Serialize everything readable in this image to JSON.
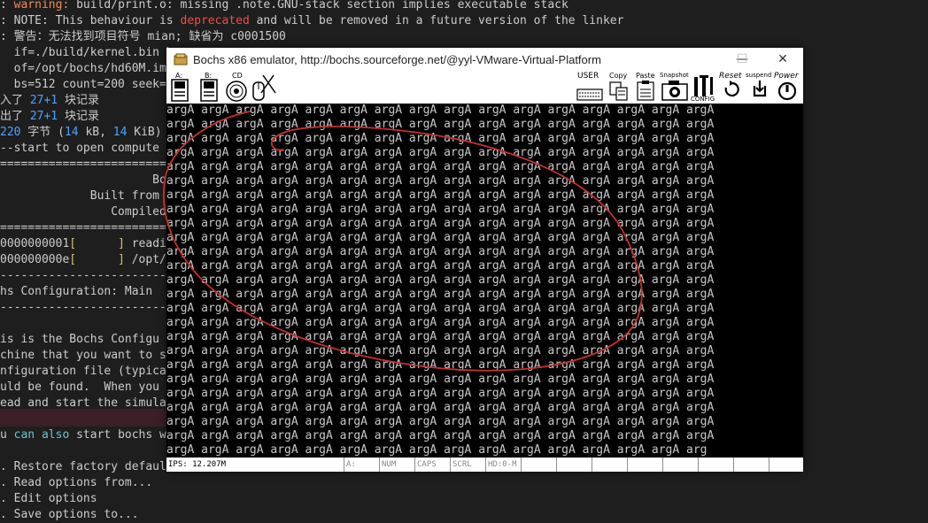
{
  "terminal": {
    "lines": [
      {
        "segments": [
          {
            "t": ": ",
            "c": ""
          },
          {
            "t": "warning:",
            "c": "c-orange"
          },
          {
            "t": " build/print.o: missing .note.GNU-stack section implies executable stack",
            "c": ""
          }
        ]
      },
      {
        "segments": [
          {
            "t": ": NOTE: This behaviour is ",
            "c": ""
          },
          {
            "t": "deprecated",
            "c": "c-red"
          },
          {
            "t": " and will be removed in a future version of the linker",
            "c": ""
          }
        ]
      },
      {
        "segments": [
          {
            "t": ": 警告：无法找到项目符号 mian; 缺省为 c0001500",
            "c": ""
          }
        ]
      },
      {
        "segments": [
          {
            "t": "  if=./build/kernel.bin \\",
            "c": ""
          }
        ]
      },
      {
        "segments": [
          {
            "t": "  of=/opt/bochs/hd60M.img",
            "c": ""
          }
        ]
      },
      {
        "segments": [
          {
            "t": "  bs=512 count=200 seek=9",
            "c": ""
          }
        ]
      },
      {
        "segments": [
          {
            "t": "入了 ",
            "c": ""
          },
          {
            "t": "27+1",
            "c": "c-blue"
          },
          {
            "t": " 块记录",
            "c": ""
          }
        ]
      },
      {
        "segments": [
          {
            "t": "出了 ",
            "c": ""
          },
          {
            "t": "27+1",
            "c": "c-blue"
          },
          {
            "t": " 块记录",
            "c": ""
          }
        ]
      },
      {
        "segments": [
          {
            "t": "220",
            "c": "c-blue"
          },
          {
            "t": " 字节 (",
            "c": ""
          },
          {
            "t": "14",
            "c": "c-blue"
          },
          {
            "t": " kB, ",
            "c": ""
          },
          {
            "t": "14",
            "c": "c-blue"
          },
          {
            "t": " KiB)",
            "c": ""
          }
        ]
      },
      {
        "segments": [
          {
            "t": "--start to open compute",
            "c": ""
          }
        ]
      },
      {
        "segments": [
          {
            "t": "========================",
            "c": ""
          }
        ]
      },
      {
        "segments": [
          {
            "t": "                      Bo",
            "c": ""
          }
        ]
      },
      {
        "segments": [
          {
            "t": "             Built from",
            "c": ""
          }
        ]
      },
      {
        "segments": [
          {
            "t": "                Compiled",
            "c": ""
          }
        ]
      },
      {
        "segments": [
          {
            "t": "========================",
            "c": ""
          }
        ]
      },
      {
        "segments": [
          {
            "t": "0000000001",
            "c": ""
          },
          {
            "t": "[      ] ",
            "c": "c-yellow"
          },
          {
            "t": "readin",
            "c": ""
          }
        ]
      },
      {
        "segments": [
          {
            "t": "000000000e",
            "c": ""
          },
          {
            "t": "[      ] ",
            "c": "c-yellow"
          },
          {
            "t": "/opt/b",
            "c": ""
          }
        ]
      },
      {
        "segments": [
          {
            "t": "------------------------",
            "c": ""
          }
        ]
      },
      {
        "segments": [
          {
            "t": "hs Configuration: Main",
            "c": ""
          }
        ]
      },
      {
        "segments": [
          {
            "t": "------------------------",
            "c": ""
          }
        ]
      },
      {
        "segments": [
          {
            "t": "",
            "c": ""
          }
        ]
      },
      {
        "segments": [
          {
            "t": "is is the Bochs Configu",
            "c": ""
          }
        ]
      },
      {
        "segments": [
          {
            "t": "chine that you want to s",
            "c": ""
          }
        ]
      },
      {
        "segments": [
          {
            "t": "nfiguration file (typica",
            "c": ""
          }
        ]
      },
      {
        "segments": [
          {
            "t": "uld be found.  When you",
            "c": ""
          }
        ]
      },
      {
        "segments": [
          {
            "t": "ead and start the simula",
            "c": ""
          }
        ]
      },
      {
        "segments": [
          {
            "t": "",
            "c": ""
          }
        ]
      },
      {
        "segments": [
          {
            "t": "u ",
            "c": ""
          },
          {
            "t": "can also",
            "c": "c-cyan"
          },
          {
            "t": " start bochs w",
            "c": ""
          }
        ]
      },
      {
        "segments": [
          {
            "t": "",
            "c": ""
          }
        ]
      },
      {
        "segments": [
          {
            "t": ". Restore factory default",
            "c": ""
          }
        ]
      },
      {
        "segments": [
          {
            "t": ". Read options from...",
            "c": ""
          }
        ]
      },
      {
        "segments": [
          {
            "t": ". Edit options",
            "c": ""
          }
        ]
      },
      {
        "segments": [
          {
            "t": ". Save options to...",
            "c": ""
          }
        ]
      }
    ]
  },
  "bochs_window": {
    "title": "Bochs x86 emulator, http://bochs.sourceforge.net/@yyl-VMware-Virtual-Platform",
    "buttons": {
      "minimize": "—",
      "maximize": "☐",
      "close": "✕"
    },
    "toolbar": {
      "floppy_a": "A:",
      "floppy_b": "B:",
      "cdrom": "CD",
      "user": "USER",
      "copy": "Copy",
      "paste": "Paste",
      "snapshot": "Snapshot",
      "config": "CONFIG",
      "reset": "Reset",
      "suspend": "suspend",
      "power": "Power"
    },
    "screen": {
      "word": "argA",
      "columns": 16,
      "rows": 25,
      "last_row": "argA argA argA argA argA argA argA argA argA argA argA argA argA argA argA arg"
    },
    "status": {
      "ips": "IPS: 12.207M",
      "drive": "A:",
      "num": "NUM",
      "caps": "CAPS",
      "scrl": "SCRL",
      "hd": "HD:0-M"
    }
  },
  "annotation": {
    "color": "#c63030"
  }
}
